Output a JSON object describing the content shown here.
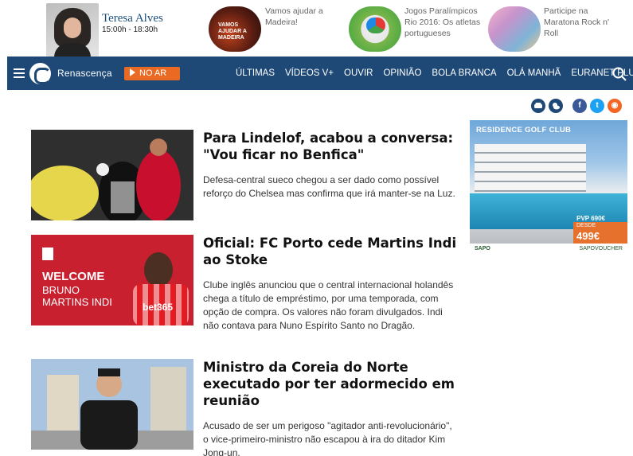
{
  "host": {
    "name": "Teresa Alves",
    "hours": "15:00h - 18:30h"
  },
  "promos": [
    {
      "text": "Vamos ajudar a Madeira!",
      "thumb_text": "VAMOS AJUDAR A MADEIRA"
    },
    {
      "text": "Jogos Paralímpicos Rio 2016: Os atletas portugueses"
    },
    {
      "text": "Participe na Maratona Rock n' Roll"
    }
  ],
  "nav": {
    "brand": "Renascença",
    "live_label": "NO AR",
    "links": [
      "ÚLTIMAS",
      "VÍDEOS V+",
      "OUVIR",
      "OPINIÃO",
      "BOLA BRANCA",
      "OLÁ MANHÃ",
      "EURANET PLUS"
    ]
  },
  "share_icons": [
    "car-icon",
    "weather-icon",
    "facebook-icon",
    "twitter-icon",
    "rss-icon"
  ],
  "share_glyphs": {
    "facebook": "f",
    "twitter": "t",
    "rss": "◉"
  },
  "articles": [
    {
      "title": "Para Lindelof, acabou a conversa: \"Vou ficar no Benfica\"",
      "description": "Defesa-central sueco chegou a ser dado como possível reforço do Chelsea mas confirma que irá manter-se na Luz."
    },
    {
      "title": "Oficial: FC Porto cede Martins Indi ao Stoke",
      "description": "Clube inglês anunciou que o central internacional holandês chega a título de empréstimo, por uma temporada, com opção de compra. Os valores não foram divulgados. Indi não contava para Nuno Espírito Santo no Dragão.",
      "thumb_text": {
        "welcome": "WELCOME",
        "line1": "BRUNO",
        "line2": "MARTINS INDI",
        "sponsor": "bet365"
      }
    },
    {
      "title": "Ministro da Coreia do Norte executado por ter adormecido em reunião",
      "description": "Acusado de ser um perigoso \"agitador anti-revolucionário\", o vice-primeiro-ministro não escapou à ira do ditador Kim Jong-un."
    }
  ],
  "ad": {
    "title": "RESIDENCE GOLF CLUB",
    "old_price": "PVP 690€",
    "from_label": "DESDE",
    "price": "499€",
    "brand": "SAPO",
    "voucher": "SAPOVOUCHER"
  },
  "colors": {
    "nav": "#1e4976",
    "accent": "#ea6a24",
    "host_name": "#1a4f7a"
  }
}
